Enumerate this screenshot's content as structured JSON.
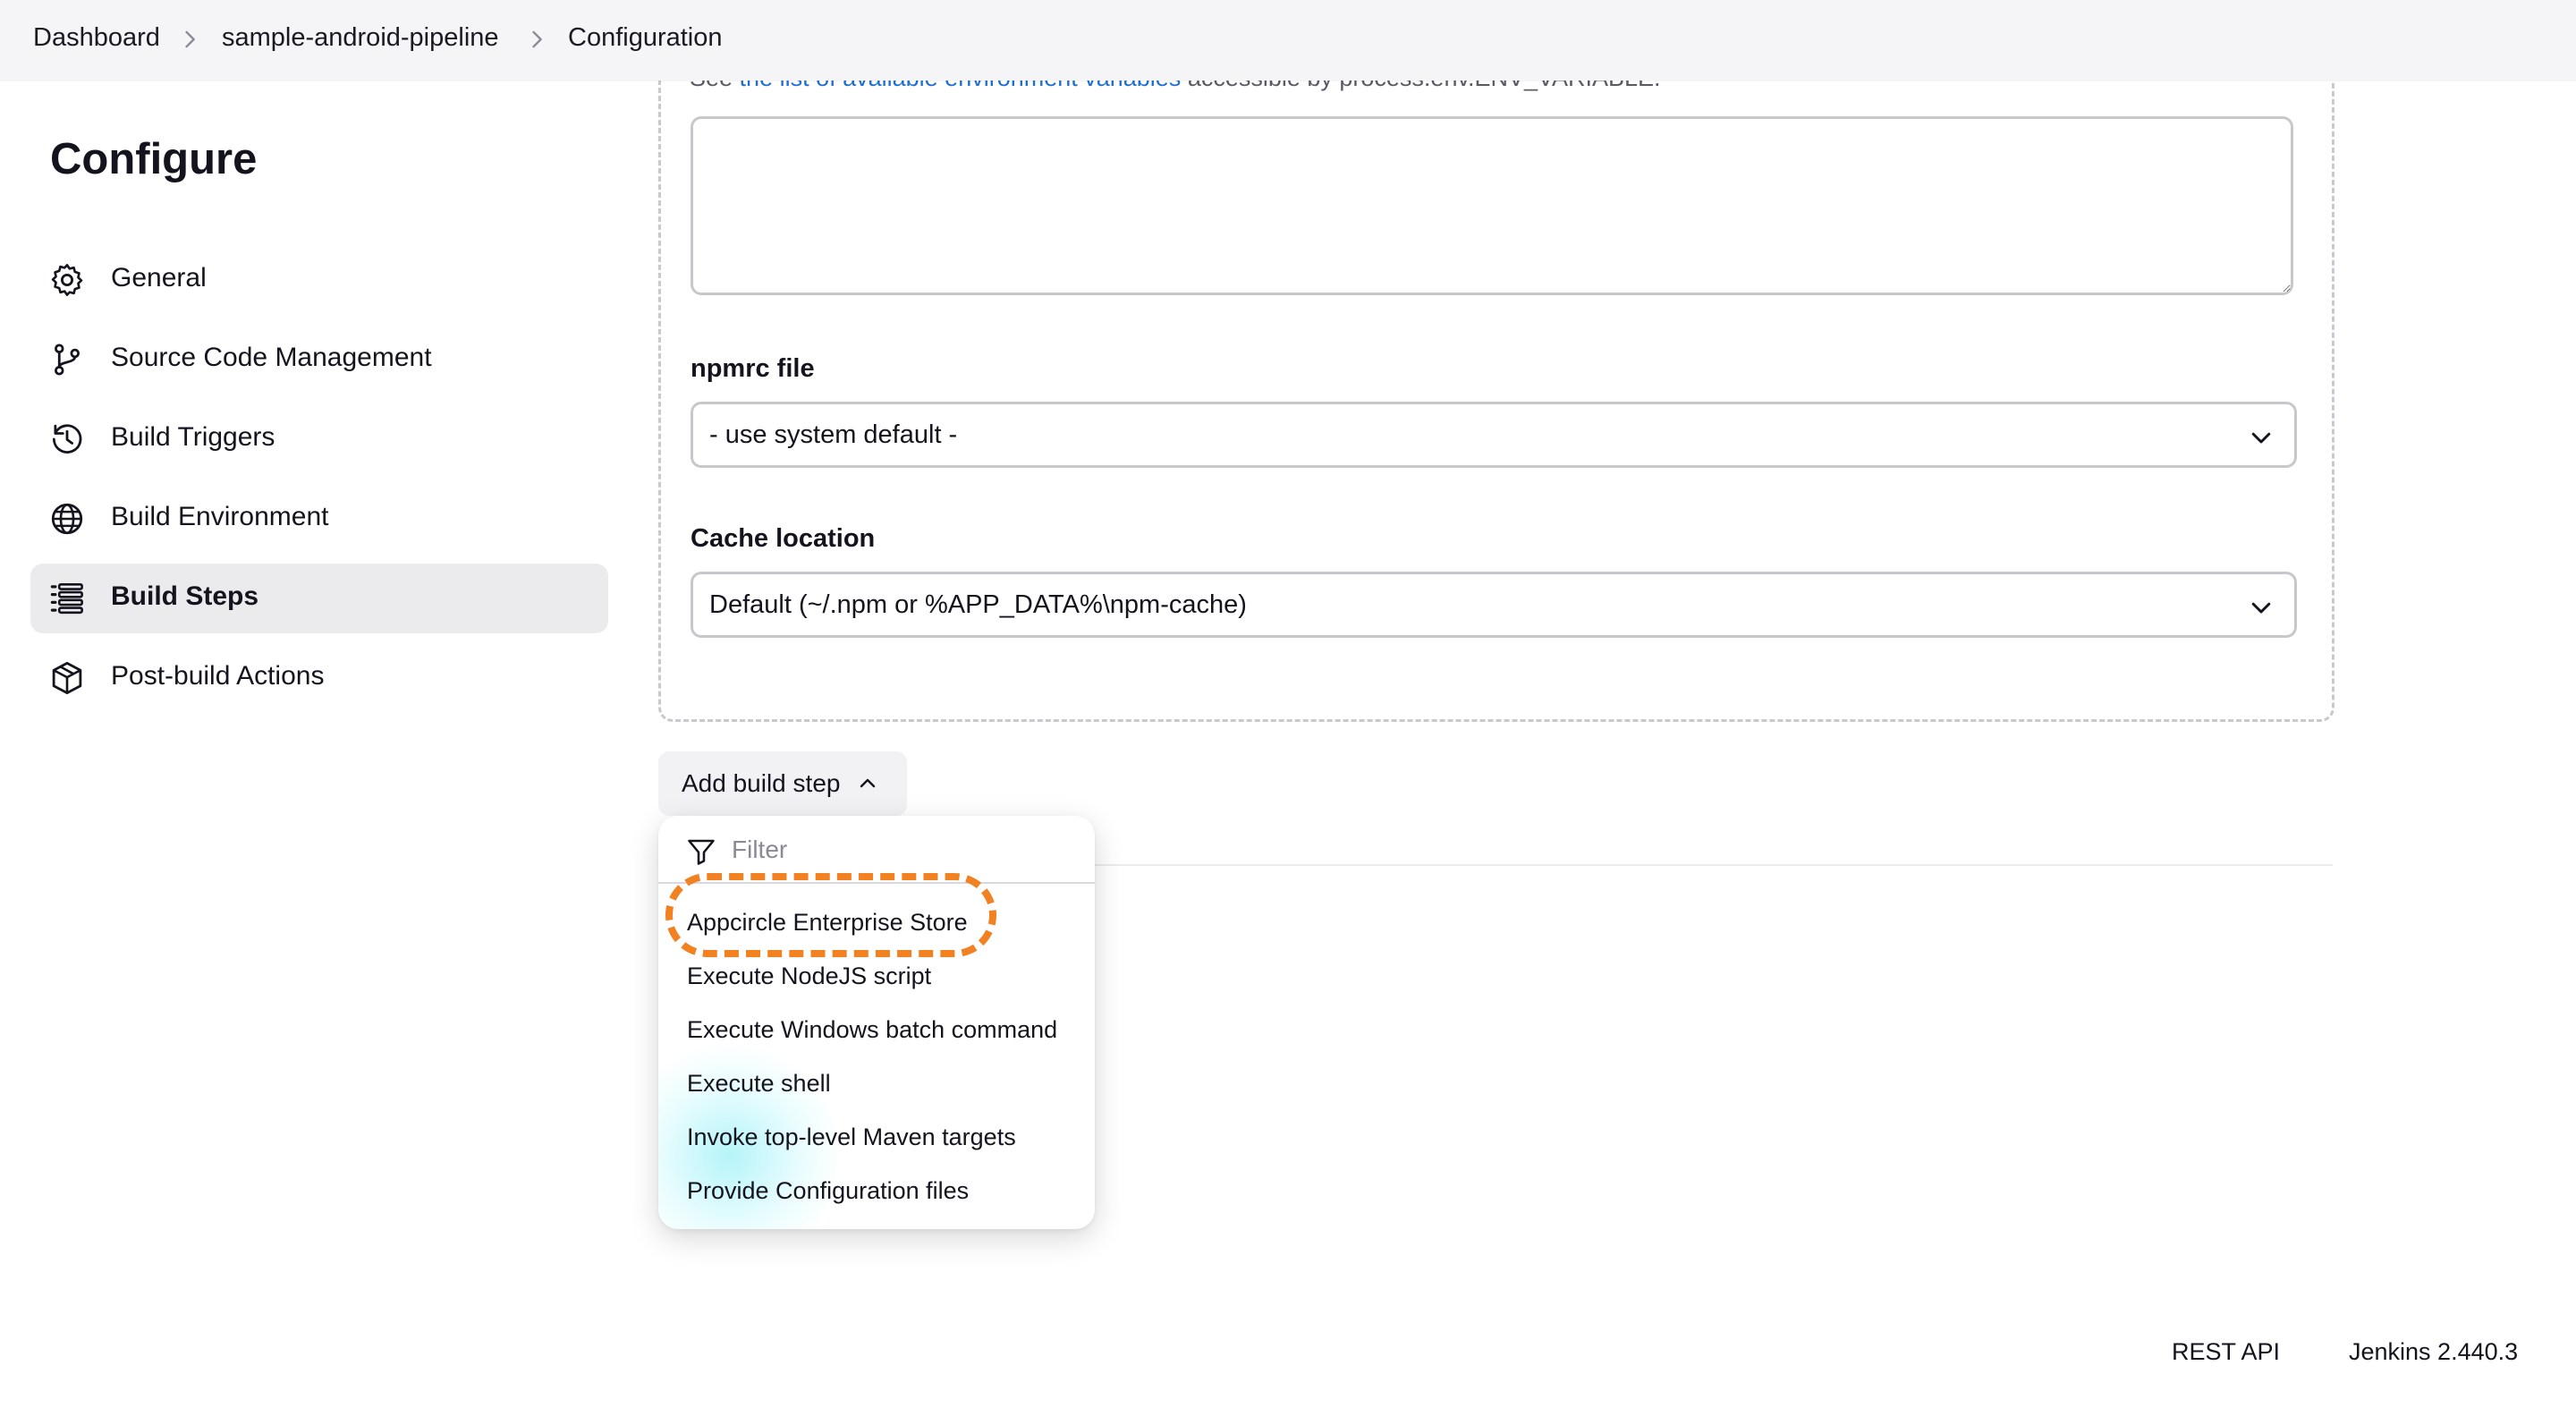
{
  "breadcrumb": {
    "items": [
      "Dashboard",
      "sample-android-pipeline",
      "Configuration"
    ]
  },
  "sidebar": {
    "title": "Configure",
    "items": [
      {
        "label": "General",
        "icon": "gear-icon"
      },
      {
        "label": "Source Code Management",
        "icon": "git-branch-icon"
      },
      {
        "label": "Build Triggers",
        "icon": "clock-icon"
      },
      {
        "label": "Build Environment",
        "icon": "globe-icon"
      },
      {
        "label": "Build Steps",
        "icon": "list-icon",
        "active": true
      },
      {
        "label": "Post-build Actions",
        "icon": "package-icon"
      }
    ]
  },
  "main": {
    "hint": {
      "prefix": "See ",
      "link_text": "the list of available environment variables",
      "suffix": " accessible by process.env.ENV_VARIABLE."
    },
    "env_textarea_value": "",
    "npmrc": {
      "label": "npmrc file",
      "value": "- use system default -"
    },
    "cache": {
      "label": "Cache location",
      "value": "Default (~/.npm or %APP_DATA%\\npm-cache)"
    },
    "add_build_step_label": "Add build step"
  },
  "menu": {
    "filter_placeholder": "Filter",
    "items": [
      "Appcircle Enterprise Store",
      "Execute NodeJS script",
      "Execute Windows batch command",
      "Execute shell",
      "Invoke top-level Maven targets",
      "Provide Configuration files"
    ]
  },
  "highlight_color": "#f28122",
  "link_color": "#1f6fd1",
  "footer": {
    "rest_api": "REST API",
    "version": "Jenkins 2.440.3"
  }
}
